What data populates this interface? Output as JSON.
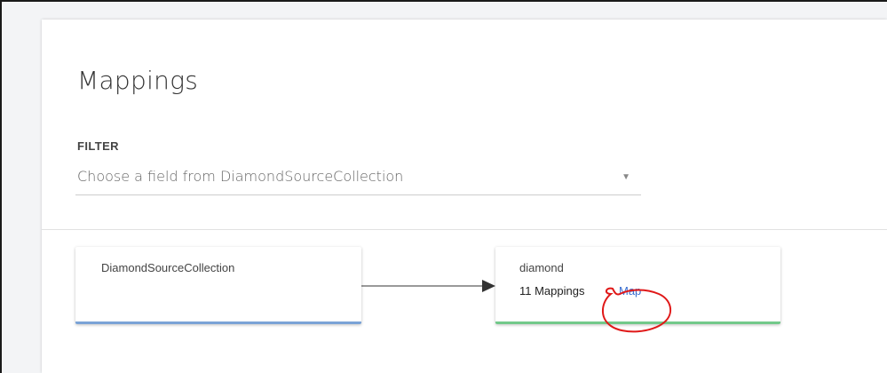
{
  "page": {
    "title": "Mappings"
  },
  "filter": {
    "label": "FILTER",
    "selected": "Choose a field from DiamondSourceCollection"
  },
  "graph": {
    "source": {
      "name": "DiamondSourceCollection",
      "accent_color": "#7aa3d6"
    },
    "target": {
      "name": "diamond",
      "count_label": "11 Mappings",
      "link_label": "Map",
      "accent_color": "#72c98a"
    },
    "edge_color": "#333333"
  },
  "annotation": {
    "color": "#e01818",
    "shape": "hand-drawn circle around Map link"
  },
  "icons": {
    "dropdown": "caret-down-icon",
    "edge_head": "arrow-head-icon"
  }
}
